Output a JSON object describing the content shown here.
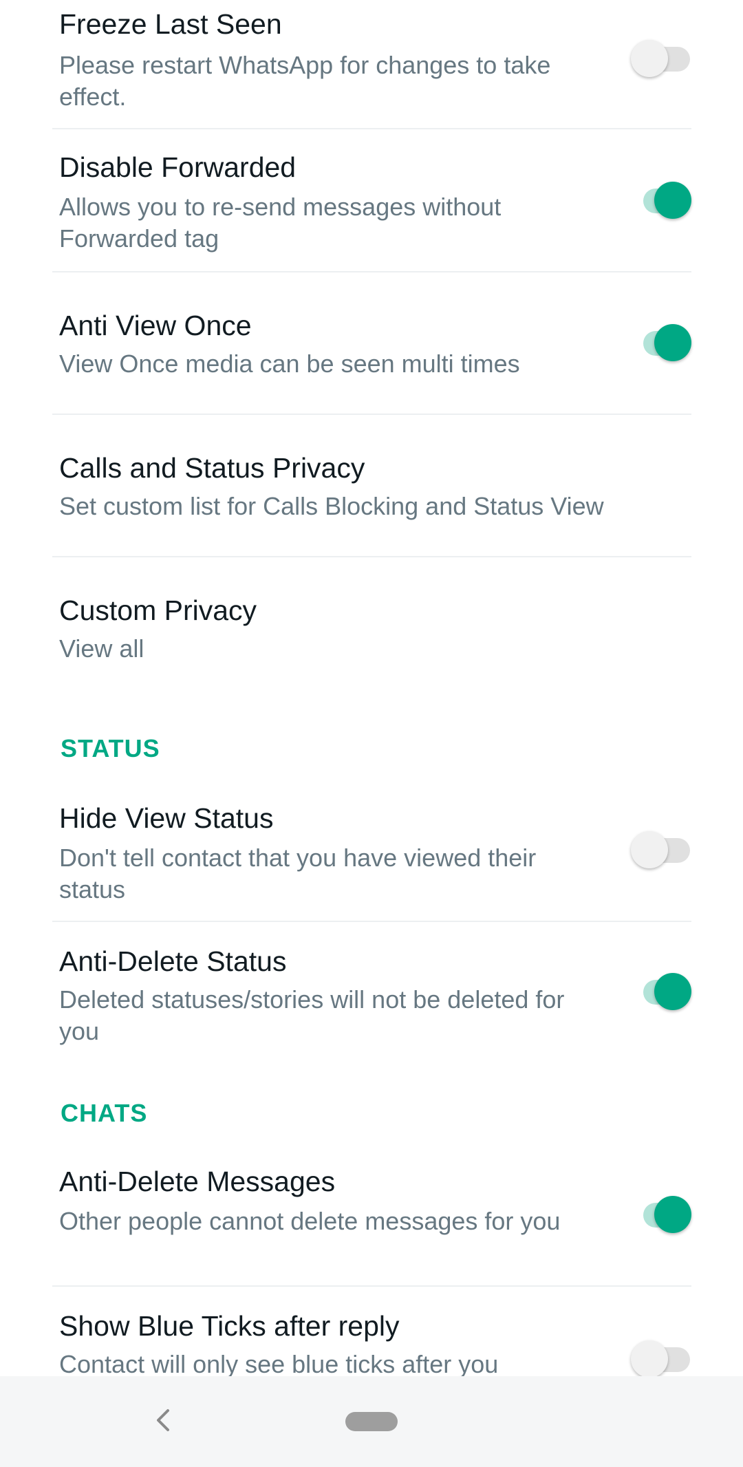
{
  "settings": {
    "freeze_last_seen": {
      "title": "Freeze Last Seen",
      "subtitle": "Please restart WhatsApp for changes to take effect.",
      "enabled": false
    },
    "disable_forwarded": {
      "title": "Disable Forwarded",
      "subtitle": "Allows you to re-send messages without Forwarded tag",
      "enabled": true
    },
    "anti_view_once": {
      "title": "Anti View Once",
      "subtitle": "View Once media can be seen multi times",
      "enabled": true
    },
    "calls_status_privacy": {
      "title": "Calls and Status Privacy",
      "subtitle": "Set custom list for Calls Blocking and Status View"
    },
    "custom_privacy": {
      "title": "Custom Privacy",
      "subtitle": "View all"
    }
  },
  "status_section": {
    "header": "STATUS",
    "hide_view_status": {
      "title": "Hide View Status",
      "subtitle": "Don't tell contact that you have viewed their status",
      "enabled": false
    },
    "anti_delete_status": {
      "title": "Anti-Delete Status",
      "subtitle": "Deleted statuses/stories will not be deleted for you",
      "enabled": true
    }
  },
  "chats_section": {
    "header": "CHATS",
    "anti_delete_messages": {
      "title": "Anti-Delete Messages",
      "subtitle": "Other people cannot delete messages for you",
      "enabled": true
    },
    "show_blue_ticks": {
      "title": "Show Blue Ticks after reply",
      "subtitle": "Contact will only see blue ticks after you",
      "enabled": false
    }
  },
  "colors": {
    "accent": "#00a884",
    "switch_track_on": "#b2e3d8",
    "title_text": "#111b21",
    "subtitle_text": "#667781"
  },
  "icons": {
    "back": "back-chevron-icon",
    "home": "home-pill-icon"
  }
}
